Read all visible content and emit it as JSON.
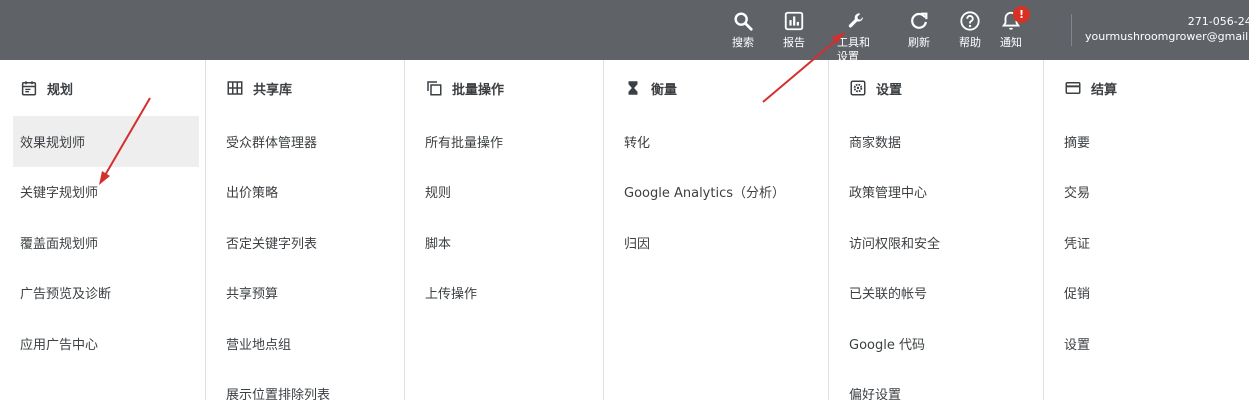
{
  "toolbar": {
    "search_label": "搜索",
    "reports_label": "报告",
    "tools_label": "工具和设置",
    "refresh_label": "刷新",
    "help_label": "帮助",
    "notifications_label": "通知",
    "notification_badge": "!"
  },
  "account": {
    "phone": "271-056-24",
    "email": "yourmushroomgrower@gmail."
  },
  "menu": {
    "planning": {
      "title": "规划",
      "icon": "calendar-icon",
      "items": [
        "效果规划师",
        "关键字规划师",
        "覆盖面规划师",
        "广告预览及诊断",
        "应用广告中心"
      ]
    },
    "shared_library": {
      "title": "共享库",
      "icon": "grid-icon",
      "items": [
        "受众群体管理器",
        "出价策略",
        "否定关键字列表",
        "共享预算",
        "营业地点组",
        "展示位置排除列表"
      ]
    },
    "bulk_actions": {
      "title": "批量操作",
      "icon": "copy-icon",
      "items": [
        "所有批量操作",
        "规则",
        "脚本",
        "上传操作"
      ]
    },
    "measurement": {
      "title": "衡量",
      "icon": "hourglass-icon",
      "items": [
        "转化",
        "Google Analytics（分析）",
        "归因"
      ]
    },
    "setup": {
      "title": "设置",
      "icon": "settings-box-icon",
      "items": [
        "商家数据",
        "政策管理中心",
        "访问权限和安全",
        "已关联的帐号",
        "Google 代码",
        "偏好设置"
      ]
    },
    "billing": {
      "title": "结算",
      "icon": "credit-card-icon",
      "items": [
        "摘要",
        "交易",
        "凭证",
        "促销",
        "设置"
      ]
    }
  },
  "colors": {
    "topbar": "#5f6368",
    "badge": "#d93025",
    "annotation": "#d32f2f",
    "active_row": "#eeeeee"
  }
}
